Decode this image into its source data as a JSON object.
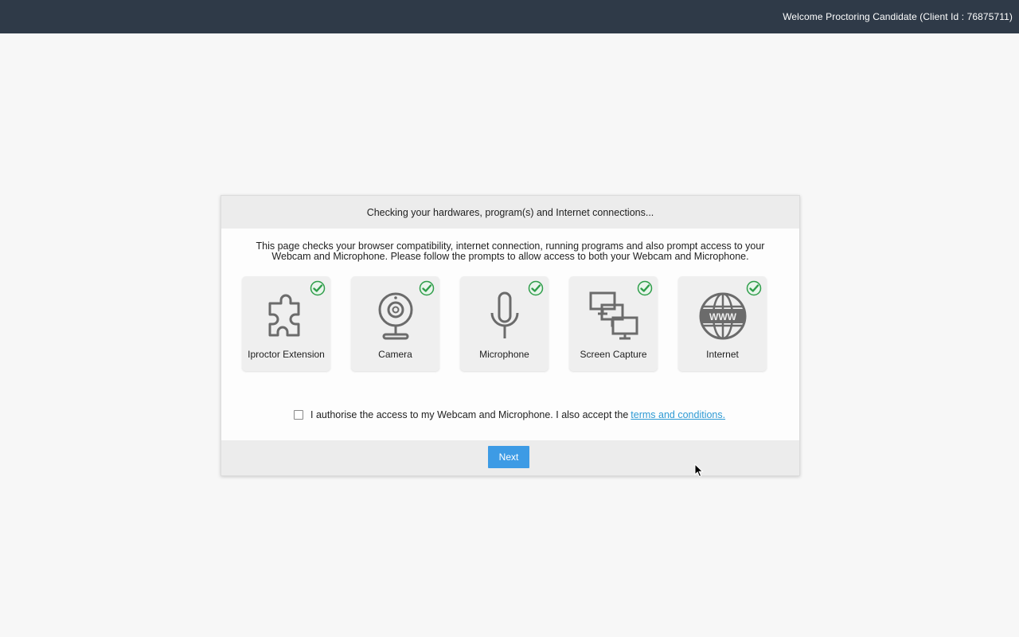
{
  "header": {
    "welcome_text": "Welcome Proctoring Candidate (Client Id : 76875711)",
    "background_color": "#2f3a48"
  },
  "dialog": {
    "title": "Checking your hardwares, program(s) and Internet connections...",
    "intro_line1": "This page checks your browser compatibility, internet connection, running programs and also prompt access to your",
    "intro_line2": "Webcam and Microphone. Please follow the prompts to allow access to both your Webcam and Microphone.",
    "checks": [
      {
        "label": "Iproctor Extension",
        "icon": "puzzle-icon",
        "status": "passed"
      },
      {
        "label": "Camera",
        "icon": "webcam-icon",
        "status": "passed"
      },
      {
        "label": "Microphone",
        "icon": "microphone-icon",
        "status": "passed"
      },
      {
        "label": "Screen Capture",
        "icon": "screen-capture-icon",
        "status": "passed"
      },
      {
        "label": "Internet",
        "icon": "globe-www-icon",
        "status": "passed"
      }
    ],
    "consent_text": "I authorise the access to my Webcam and Microphone. I also accept the",
    "consent_link": "terms and conditions.",
    "consent_checked": false,
    "next_label": "Next"
  },
  "colors": {
    "accent": "#3d9be5",
    "link": "#2e9ad4",
    "check_green": "#2f9e4a"
  }
}
